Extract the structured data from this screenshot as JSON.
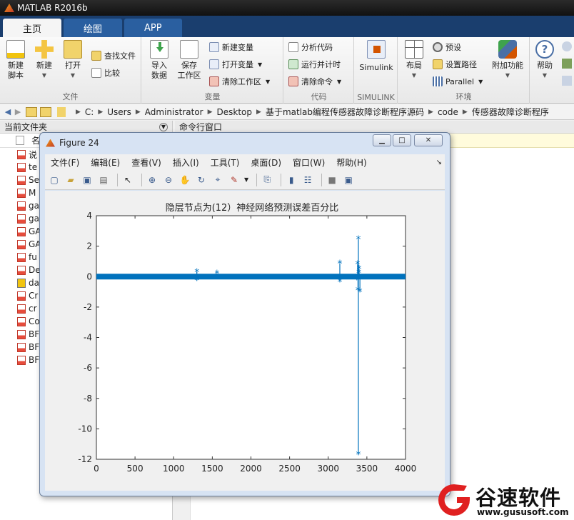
{
  "window": {
    "title": "MATLAB R2016b"
  },
  "tabs": [
    "主页",
    "绘图",
    "APP"
  ],
  "ribbon": {
    "file_group": {
      "label": "文件",
      "new_script": "新建\n脚本",
      "new": "新建",
      "open": "打开",
      "find_files": "查找文件",
      "compare": "比较"
    },
    "variable_group": {
      "label": "变量",
      "import_data": "导入\n数据",
      "save_workspace": "保存\n工作区",
      "new_variable": "新建变量",
      "open_variable": "打开变量",
      "clear_workspace": "清除工作区"
    },
    "code_group": {
      "label": "代码",
      "analyze_code": "分析代码",
      "run_and_time": "运行并计时",
      "clear_commands": "清除命令"
    },
    "simulink_group": {
      "label": "SIMULINK",
      "simulink": "Simulink"
    },
    "environment_group": {
      "label": "环境",
      "layout": "布局",
      "preferences": "预设",
      "set_path": "设置路径",
      "parallel": "Parallel",
      "addons": "附加功能"
    },
    "resources_group": {
      "help": "帮助"
    }
  },
  "address": {
    "crumbs": [
      "C:",
      "Users",
      "Administrator",
      "Desktop",
      "基于matlab编程传感器故障诊断程序源码",
      "code",
      "传感器故障诊断程序"
    ]
  },
  "current_folder": {
    "title": "当前文件夹",
    "column_header": "名",
    "files": [
      "说",
      "te",
      "Se",
      "M",
      "ga",
      "ga",
      "GA",
      "GA",
      "fu",
      "De",
      "da",
      "Cr",
      "cr",
      "Co",
      "BF",
      "BF",
      "BF"
    ]
  },
  "command_window": {
    "title": "命令行窗口"
  },
  "figure": {
    "title": "Figure 24",
    "menu": [
      "文件(F)",
      "编辑(E)",
      "查看(V)",
      "插入(I)",
      "工具(T)",
      "桌面(D)",
      "窗口(W)",
      "帮助(H)"
    ]
  },
  "chart_data": {
    "type": "line",
    "title": "隐层节点为(12）神经网络预测误差百分比",
    "xlabel": "",
    "ylabel": "",
    "xlim": [
      0,
      4000
    ],
    "ylim": [
      -12,
      4
    ],
    "xticks": [
      0,
      500,
      1000,
      1500,
      2000,
      2500,
      3000,
      3500,
      4000
    ],
    "yticks": [
      4,
      2,
      0,
      -2,
      -4,
      -6,
      -8,
      -10,
      -12
    ],
    "series_color": "#0072bd",
    "marker": "*",
    "baseline": {
      "x_start": 0,
      "x_end": 4000,
      "y": 0
    },
    "spikes": [
      {
        "x": 1300,
        "y": 0.3
      },
      {
        "x": 1300,
        "y": -0.25
      },
      {
        "x": 1560,
        "y": 0.2
      },
      {
        "x": 3150,
        "y": 0.85
      },
      {
        "x": 3150,
        "y": -0.35
      },
      {
        "x": 3390,
        "y": 2.45
      },
      {
        "x": 3390,
        "y": -11.7
      },
      {
        "x": 3380,
        "y": 0.8
      },
      {
        "x": 3400,
        "y": 0.5
      },
      {
        "x": 3370,
        "y": -0.2
      },
      {
        "x": 3385,
        "y": -0.9
      },
      {
        "x": 3410,
        "y": -1.0
      },
      {
        "x": 3395,
        "y": 0.25
      }
    ]
  },
  "watermark": {
    "brand": "谷速软件",
    "url": "www.gususoft.com"
  }
}
